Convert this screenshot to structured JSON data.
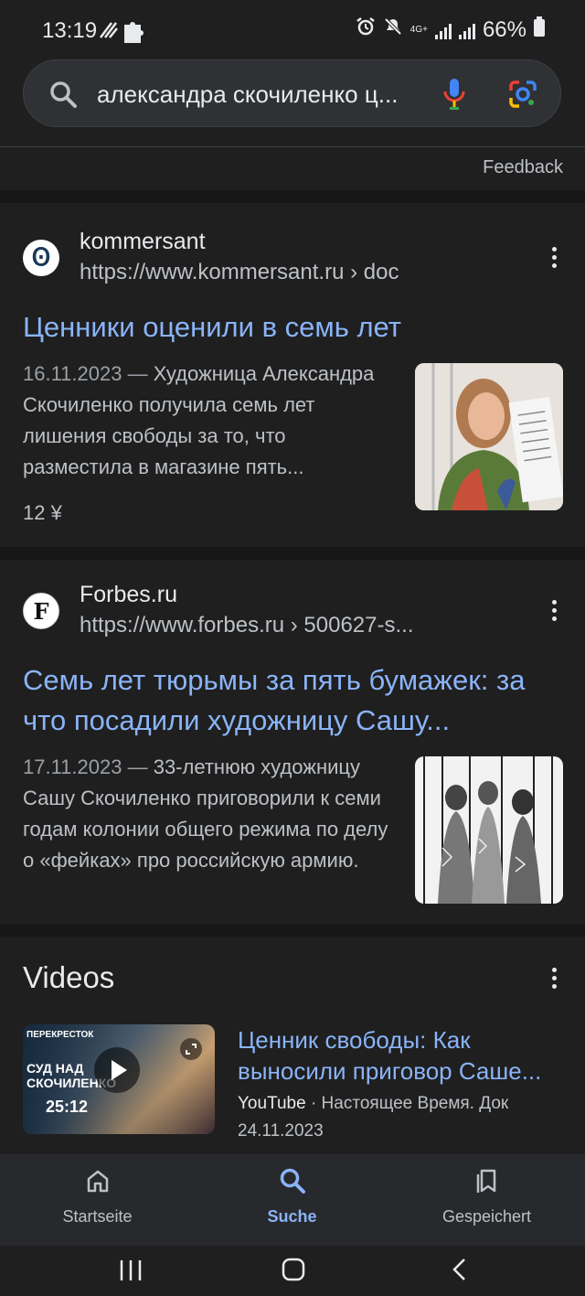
{
  "status_bar": {
    "time": "13:19",
    "network": "4G+",
    "battery": "66%"
  },
  "search": {
    "query": "александра скочиленко ц..."
  },
  "feedback": "Feedback",
  "results": [
    {
      "site_name": "kommersant",
      "url": "https://www.kommersant.ru › doc",
      "favicon_letter": "Ꙩ",
      "title": "Ценники оценили в семь лет",
      "date": "16.11.2023 —",
      "snippet": " Художница Александра Скочиленко получила семь лет лишения свободы за то, что разместила в магазине пять...",
      "price": "12 ¥"
    },
    {
      "site_name": "Forbes.ru",
      "url": "https://www.forbes.ru › 500627-s...",
      "favicon_letter": "F",
      "title": "Семь лет тюрьмы за пять бумажек: за что посадили художницу Сашу...",
      "date": "17.11.2023 —",
      "snippet": " 33-летнюю художницу Сашу Скочиленко приговорили к семи годам колонии общего режима по делу о «фейках» про российскую армию."
    }
  ],
  "videos": {
    "heading": "Videos",
    "items": [
      {
        "title": "Ценник свободы: Как выносили приговор Саше...",
        "source": "YouTube",
        "channel": "· Настоящее Время. Док",
        "date": "24.11.2023",
        "duration": "25:12",
        "thumb_text_top": "ПЕРЕКРЕСТОК",
        "thumb_text_main": "СУД НАД СКОЧИЛЕНКО"
      }
    ]
  },
  "bottom_nav": [
    {
      "label": "Startseite",
      "icon": "home-icon",
      "active": false
    },
    {
      "label": "Suche",
      "icon": "search-icon",
      "active": true
    },
    {
      "label": "Gespeichert",
      "icon": "bookmarks-icon",
      "active": false
    }
  ],
  "colors": {
    "background": "#1f1f1f",
    "link": "#8ab4f8",
    "active_nav": "#8ab4f8"
  }
}
